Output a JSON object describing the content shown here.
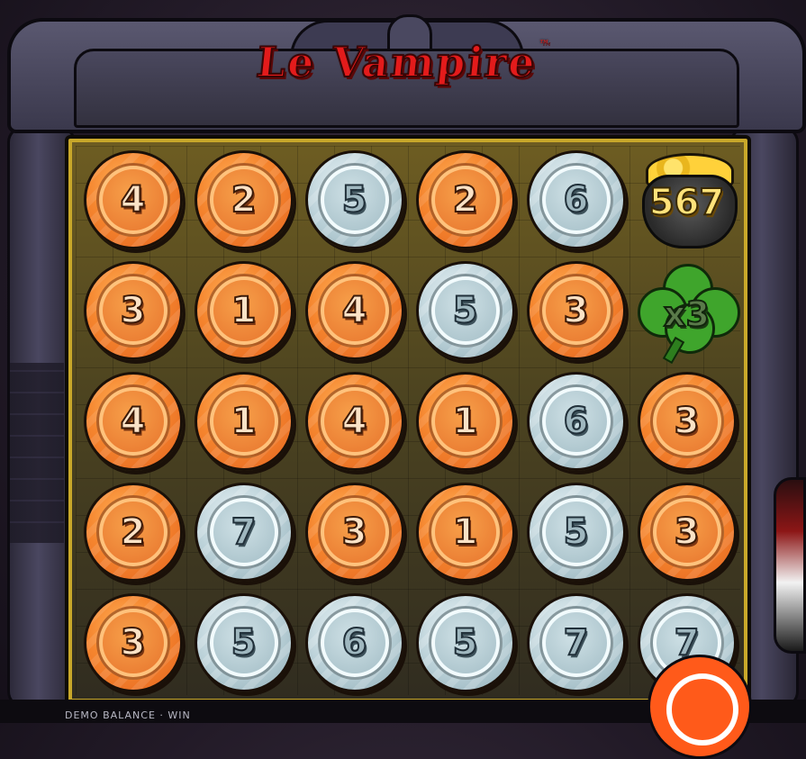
{
  "game": {
    "title": "Le Vampire",
    "trademark": "™"
  },
  "grid": [
    [
      {
        "type": "copper",
        "value": "4"
      },
      {
        "type": "copper",
        "value": "2"
      },
      {
        "type": "silver",
        "value": "5"
      },
      {
        "type": "copper",
        "value": "2"
      },
      {
        "type": "silver",
        "value": "6"
      },
      {
        "type": "pot",
        "value": "567"
      }
    ],
    [
      {
        "type": "copper",
        "value": "3"
      },
      {
        "type": "copper",
        "value": "1"
      },
      {
        "type": "copper",
        "value": "4"
      },
      {
        "type": "silver",
        "value": "5"
      },
      {
        "type": "copper",
        "value": "3"
      },
      {
        "type": "clover",
        "value": "x3"
      }
    ],
    [
      {
        "type": "copper",
        "value": "4"
      },
      {
        "type": "copper",
        "value": "1"
      },
      {
        "type": "copper",
        "value": "4"
      },
      {
        "type": "copper",
        "value": "1"
      },
      {
        "type": "silver",
        "value": "6"
      },
      {
        "type": "copper",
        "value": "3"
      }
    ],
    [
      {
        "type": "copper",
        "value": "2"
      },
      {
        "type": "silver",
        "value": "7"
      },
      {
        "type": "copper",
        "value": "3"
      },
      {
        "type": "copper",
        "value": "1"
      },
      {
        "type": "silver",
        "value": "5"
      },
      {
        "type": "copper",
        "value": "3"
      }
    ],
    [
      {
        "type": "copper",
        "value": "3"
      },
      {
        "type": "silver",
        "value": "5"
      },
      {
        "type": "silver",
        "value": "6"
      },
      {
        "type": "silver",
        "value": "5"
      },
      {
        "type": "silver",
        "value": "7"
      },
      {
        "type": "silver",
        "value": "7"
      }
    ]
  ],
  "hud": {
    "balance_label": "DEMO BALANCE · WIN"
  },
  "colors": {
    "copper": "#f5852e",
    "silver": "#bcd2d9",
    "board": "#4d4420",
    "title_red": "#e31b1b",
    "spin_button": "#ff5a1a"
  }
}
